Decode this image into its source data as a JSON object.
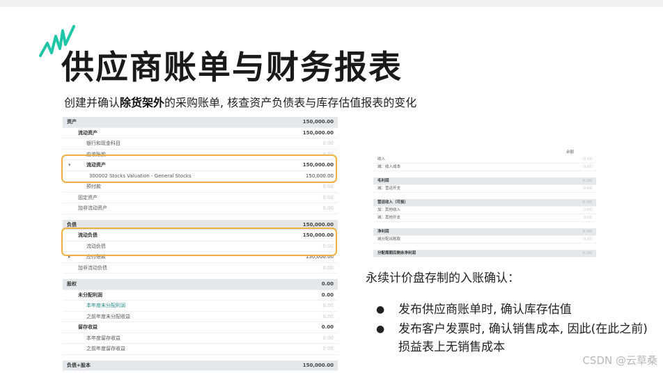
{
  "slide": {
    "title": "供应商账单与财务报表",
    "subtitle_parts": [
      "创建并确认",
      "除货架外",
      "的采购账单, 核查资产负债表与库存估值报表的变化"
    ]
  },
  "balance_sheet": {
    "rows": [
      {
        "label": "资产",
        "value": "150,000.00",
        "type": "head"
      },
      {
        "label": "流动资产",
        "value": "150,000.00",
        "type": "sub",
        "indent": 1
      },
      {
        "label": "银行和现金科目",
        "value": "0.00",
        "type": "row",
        "indent": 2,
        "faint": true
      },
      {
        "label": "应收账款",
        "value": "0.00",
        "type": "row",
        "indent": 2,
        "faint": true
      },
      {
        "label": "流动资产",
        "value": "150,000.00",
        "type": "sub",
        "indent": 2,
        "caret": "▾"
      },
      {
        "label": "300002 Stocks Valuation - General Stocks",
        "value": "150,000.00",
        "type": "row",
        "indent": 3
      },
      {
        "label": "预付款",
        "value": "0.00",
        "type": "row",
        "indent": 2,
        "faint": true
      },
      {
        "label": "固定资产",
        "value": "0.00",
        "type": "row",
        "indent": 1,
        "faint": true
      },
      {
        "label": "加非流动资产",
        "value": "0.00",
        "type": "row",
        "indent": 1,
        "faint": true
      },
      {
        "type": "gap"
      },
      {
        "label": "负债",
        "value": "150,000.00",
        "type": "head"
      },
      {
        "label": "流动负债",
        "value": "150,000.00",
        "type": "sub",
        "indent": 1
      },
      {
        "label": "流动负债",
        "value": "0.00",
        "type": "row",
        "indent": 2,
        "faint": true
      },
      {
        "label": "应付账款",
        "value": "150,000.00",
        "type": "row",
        "indent": 2,
        "caret": "▸"
      },
      {
        "label": "加非流动负债",
        "value": "0.00",
        "type": "row",
        "indent": 1,
        "faint": true
      },
      {
        "type": "gap"
      },
      {
        "label": "股权",
        "value": "0.00",
        "type": "head"
      },
      {
        "label": "未分配利润",
        "value": "0.00",
        "type": "sub",
        "indent": 1
      },
      {
        "label": "本年度未分配利润",
        "value": "0.00",
        "type": "row",
        "indent": 2,
        "faint": true,
        "teal": true
      },
      {
        "label": "之前年度未分配收益",
        "value": "0.00",
        "type": "row",
        "indent": 2,
        "faint": true
      },
      {
        "label": "留存收益",
        "value": "0.00",
        "type": "sub",
        "indent": 1
      },
      {
        "label": "本年度留存收益",
        "value": "0.00",
        "type": "row",
        "indent": 2,
        "faint": true
      },
      {
        "label": "之前年度留存收益",
        "value": "0.00",
        "type": "row",
        "indent": 2,
        "faint": true
      },
      {
        "type": "gap"
      },
      {
        "label": "负债+股本",
        "value": "150,000.00",
        "type": "head"
      }
    ]
  },
  "profit_loss": {
    "column_header": "余额",
    "rows": [
      {
        "label": "收入",
        "value": "0.00"
      },
      {
        "label": "减：收入成本",
        "value": "0.00"
      },
      {
        "type": "gap"
      },
      {
        "label": "毛利润",
        "value": "0.00",
        "type": "head"
      },
      {
        "label": "减：营运开支",
        "value": "0.00"
      },
      {
        "type": "gap"
      },
      {
        "label": "营运收入（可损）",
        "value": "0.00",
        "type": "head"
      },
      {
        "label": "加：其他收入",
        "value": "0.00"
      },
      {
        "label": "减：其他开支",
        "value": "0.00"
      },
      {
        "type": "gap"
      },
      {
        "label": "净利润",
        "value": "0.00",
        "type": "head"
      },
      {
        "label": "减分配出账款",
        "value": "0.00"
      },
      {
        "type": "gap"
      },
      {
        "label": "分配周期后剩余净利润",
        "value": "0.00",
        "type": "head"
      }
    ]
  },
  "notes": {
    "heading": "永续计价盘存制的入账确认：",
    "bullets": [
      "发布供应商账单时, 确认库存估值",
      "发布客户发票时, 确认销售成本, 因此(在此之前)损益表上无销售成本"
    ],
    "bullet_glyph": "●"
  },
  "watermark": "CSDN @云草桑",
  "colors": {
    "highlight": "#f0b040",
    "accent": "#1fc7a8",
    "header_bg": "#e6e7ea"
  }
}
